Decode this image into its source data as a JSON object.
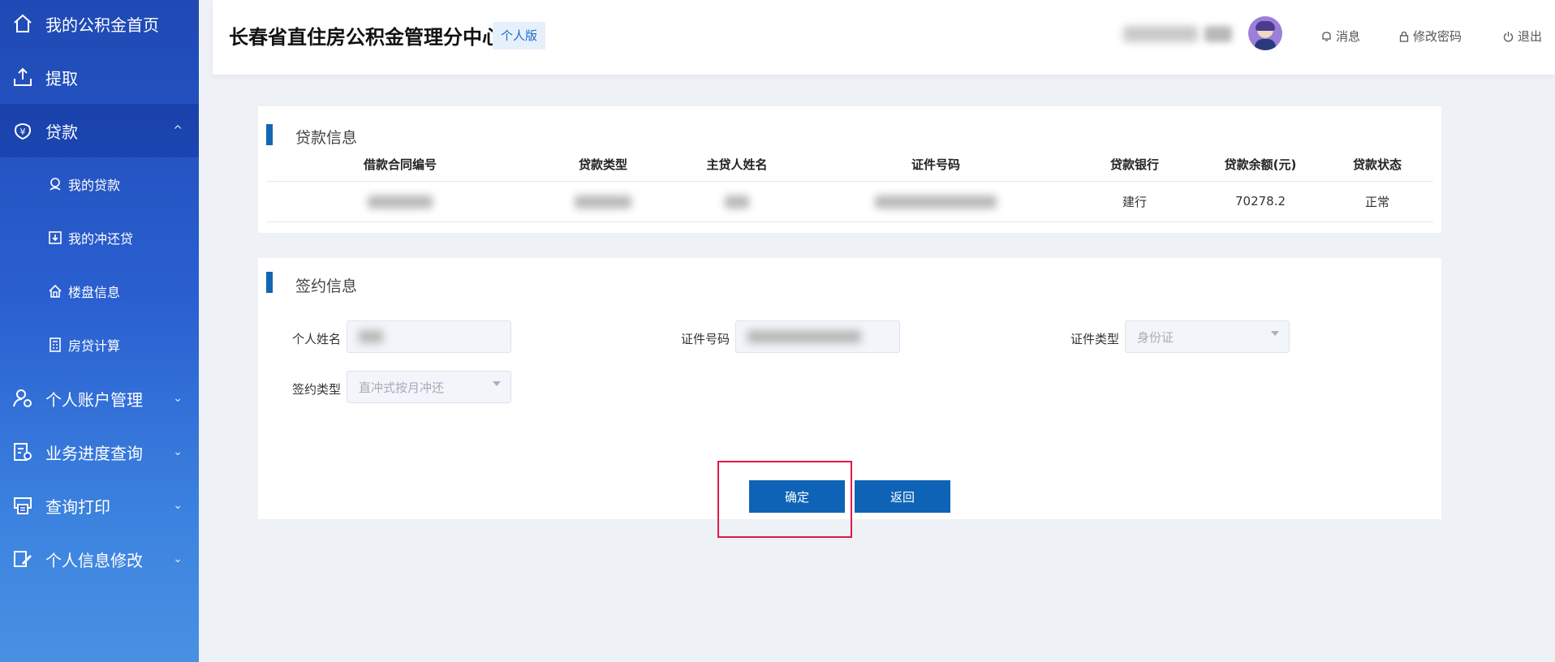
{
  "sidebar": {
    "items": [
      {
        "label": "我的公积金首页",
        "icon": "home-icon"
      },
      {
        "label": "提取",
        "icon": "upload-icon"
      },
      {
        "label": "贷款",
        "icon": "yuan-icon",
        "arrow": "^"
      },
      {
        "label": "个人账户管理",
        "icon": "user-settings-icon",
        "arrow": "⌄"
      },
      {
        "label": "业务进度查询",
        "icon": "progress-icon",
        "arrow": "⌄"
      },
      {
        "label": "查询打印",
        "icon": "printer-icon",
        "arrow": "⌄"
      },
      {
        "label": "个人信息修改",
        "icon": "edit-icon",
        "arrow": "⌄"
      }
    ],
    "subitems": [
      {
        "label": "我的贷款",
        "icon": "loan-icon"
      },
      {
        "label": "我的冲还贷",
        "icon": "repay-icon"
      },
      {
        "label": "楼盘信息",
        "icon": "building-icon"
      },
      {
        "label": "房贷计算",
        "icon": "calculator-icon"
      }
    ]
  },
  "header": {
    "title": "长春省直住房公积金管理分中心",
    "edition": "个人版",
    "messages": "消息",
    "change_password": "修改密码",
    "logout": "退出"
  },
  "loan_info": {
    "title": "贷款信息",
    "columns": [
      "借款合同编号",
      "贷款类型",
      "主贷人姓名",
      "证件号码",
      "贷款银行",
      "贷款余额(元)",
      "贷款状态"
    ],
    "row": {
      "bank": "建行",
      "balance": "70278.2",
      "status": "正常"
    }
  },
  "sign_info": {
    "title": "签约信息",
    "name_label": "个人姓名",
    "id_label": "证件号码",
    "id_type_label": "证件类型",
    "id_type_value": "身份证",
    "sign_type_label": "签约类型",
    "sign_type_value": "直冲式按月冲还"
  },
  "actions": {
    "confirm": "确定",
    "back": "返回"
  },
  "colors": {
    "sidebar_top": "#1f49b4",
    "sidebar_bottom": "#4a90e2",
    "primary": "#0e63b6",
    "highlight": "#e3174a"
  }
}
